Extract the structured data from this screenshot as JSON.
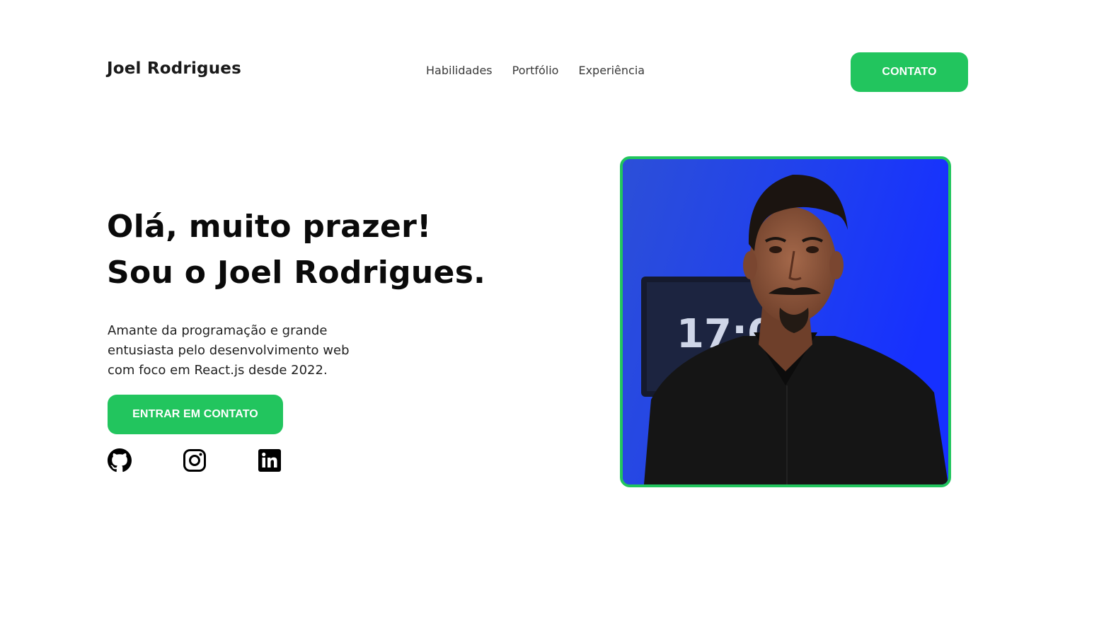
{
  "header": {
    "logo": "Joel Rodrigues",
    "nav": [
      "Habilidades",
      "Portfólio",
      "Experiência"
    ],
    "cta_label": "CONTATO"
  },
  "hero": {
    "title_line1": "Olá, muito prazer!",
    "title_line2": "Sou o Joel Rodrigues.",
    "description": "Amante da programação e grande entusiasta pelo desenvolvimento web com foco em React.js desde 2022.",
    "cta_label": "ENTRAR EM CONTATO"
  },
  "socials": [
    "github-icon",
    "instagram-icon",
    "linkedin-icon"
  ],
  "photo": {
    "monitor_text": "17:00"
  },
  "colors": {
    "accent": "#22c55e",
    "photo_background": "#1c3ce0"
  }
}
